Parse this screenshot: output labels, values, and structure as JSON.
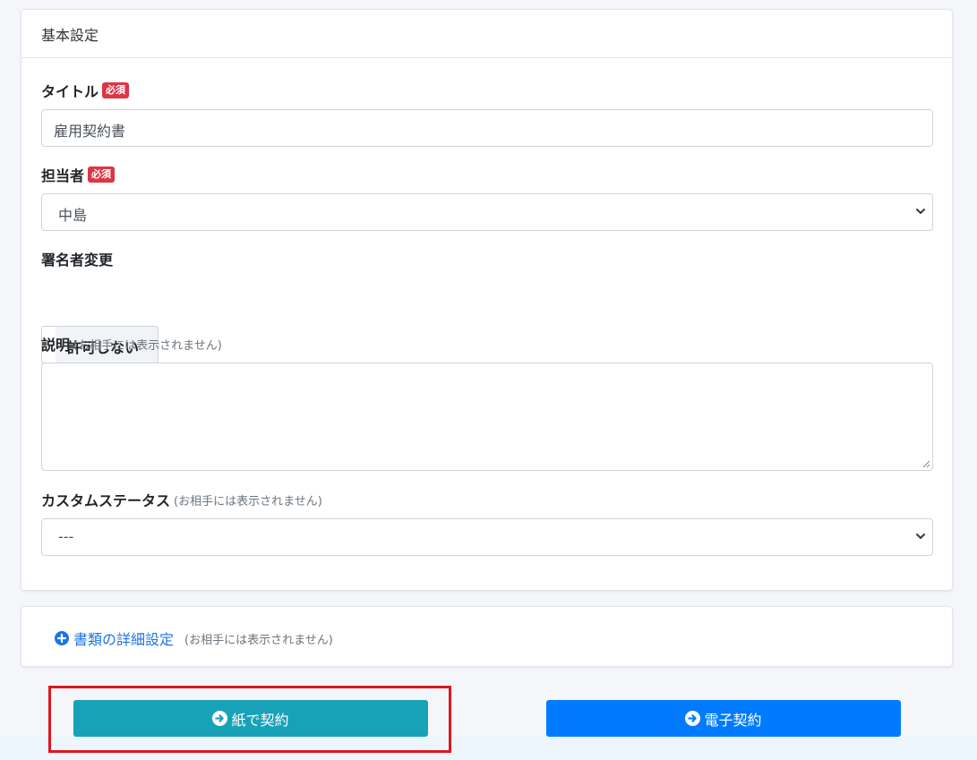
{
  "basic_settings": {
    "header": "基本設定",
    "required_badge": "必須",
    "title_label": "タイトル",
    "title_value": "雇用契約書",
    "assignee_label": "担当者",
    "assignee_value": "中島",
    "signer_change_label": "署名者変更",
    "signer_change_toggle": "許可しない",
    "description_label": "説明",
    "description_hint": "(お相手には表示されません)",
    "description_value": "",
    "custom_status_label": "カスタムステータス",
    "custom_status_hint": "(お相手には表示されません)",
    "custom_status_value": "---"
  },
  "detail_settings": {
    "link_label": "書類の詳細設定",
    "hint": "(お相手には表示されません)"
  },
  "actions": {
    "paper_contract": "紙で契約",
    "digital_contract": "電子契約"
  },
  "colors": {
    "required": "#dc3545",
    "paper_button": "#17a2b8",
    "digital_button": "#007bff",
    "link": "#1a73e8",
    "highlight": "#e0161e"
  }
}
